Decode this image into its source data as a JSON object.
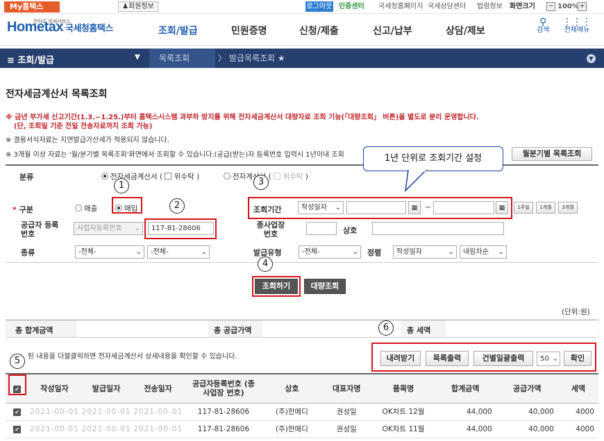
{
  "topbar": {
    "my_hometax": "My홈택스",
    "member_info": "회원정보",
    "logout": "로그아웃",
    "cert_center": "인증센터",
    "links": [
      "국세청홈페이지",
      "국세상담센터",
      "법령정보"
    ],
    "screen_size_label": "화면크기",
    "zoom_minus": "−",
    "zoom": "100%",
    "zoom_plus": "+"
  },
  "header": {
    "logo_small": "전자로 넣세서비스",
    "logo": "Hometax",
    "logo_sub": "국세청홈택스",
    "nav": [
      "조회/발급",
      "민원증명",
      "신청/제출",
      "신고/납부",
      "상담/제보"
    ],
    "search": "검색",
    "all_menu": "전체메뉴"
  },
  "subnav": {
    "menu": "≡ 조회/발급",
    "crumb1": "목록조회",
    "crumb2": "발급목록조회"
  },
  "page": {
    "title": "전자세금계산서 목록조회",
    "notice1": "※ 금년 부가세 신고기간(1.3.~1.25.)부터 홈택스시스템 과부하 방지를 위해 전자세금계산서 대량자료 조회 기능(「대량조회」 버튼)을 별도로 분리 운영합니다.",
    "notice1b": "(단, 조회일 기준 전일 전송자료까지 조회 가능)",
    "notice2": "※ 결용서식자료는 지연발급가산세가 적용되지 않습니다.",
    "notice3": "※ 3개월 이상 자료는 '월/분기별 목록조회'화면에서 조회할 수 있습니다.(공급(받는)자 등록번호 입력시 1년이내 조회",
    "monthly_btn": "월분기별 목록조회",
    "unit": "(단위:원)",
    "callout": "1년 단위로 조회기간 설정"
  },
  "filter": {
    "category_label": "분류",
    "cat_opt1": "전자세금계산서",
    "cat_trust1": "위수탁",
    "cat_opt2": "전자계산서",
    "cat_trust2": "위수탁",
    "type_label": "구분",
    "sale": "매출",
    "purchase": "매입",
    "supplier_label": "공급자 등록번호",
    "supplier_select": "사업자등록번호",
    "supplier_value": "117-81-28606",
    "kind_label": "종류",
    "kind1": "-전체-",
    "kind2": "-전체-",
    "period_label": "조회기간",
    "period_select": "작성일자",
    "tilde": "~",
    "quick": [
      "1주일",
      "1개월",
      "3개월"
    ],
    "branch_label": "종사업장 번호",
    "company_label": "상호",
    "issue_type_label": "발급유형",
    "issue_type": "-전체-",
    "sort_label": "정렬",
    "sort_field": "작성일자",
    "sort_order": "내림차순"
  },
  "buttons": {
    "search": "조회하기",
    "bulk": "대량조회",
    "download": "내려받기",
    "print_list": "목록출력",
    "print_each": "건별일괄출력",
    "page_size": "50",
    "confirm": "확인"
  },
  "summary": {
    "total_label": "총 합계금액",
    "supply_label": "총 공급가액",
    "tax_label": "총 세액"
  },
  "hint": "된 내용을 더블클릭하면 전자세금계산서 상세내용을 확인할 수 있습니다.",
  "markers": [
    "1",
    "2",
    "3",
    "4",
    "5",
    "6"
  ],
  "table": {
    "headers": [
      "작성일자",
      "발급일자",
      "전송일자",
      "공급자등록번호 (종사업장 번호)",
      "상호",
      "대표자명",
      "품목명",
      "합계금액",
      "공급가액",
      "세액"
    ],
    "rows": [
      {
        "masked": "2021-00-01",
        "supplier": "117-81-28606",
        "company": "(주)한메디",
        "ceo": "권성일",
        "item": "OK차트 12월",
        "total": "44,000",
        "supply": "40,000",
        "tax": "4000"
      },
      {
        "masked": "2021-00-01",
        "supplier": "117-81-28606",
        "company": "(주)한메디",
        "ceo": "권성일",
        "item": "OK차트 11월",
        "total": "44,000",
        "supply": "40,000",
        "tax": "4000"
      }
    ]
  }
}
